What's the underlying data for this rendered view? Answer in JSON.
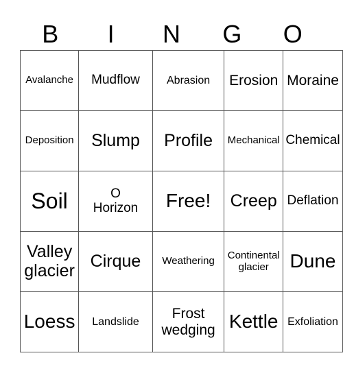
{
  "header": [
    "B",
    "I",
    "N",
    "G",
    "O"
  ],
  "rows": [
    [
      "Avalanche",
      "Mudflow",
      "Abrasion",
      "Erosion",
      "Moraine"
    ],
    [
      "Deposition",
      "Slump",
      "Profile",
      "Mechanical",
      "Chemical"
    ],
    [
      "Soil",
      "O Horizon",
      "Free!",
      "Creep",
      "Deflation"
    ],
    [
      "Valley glacier",
      "Cirque",
      "Weathering",
      "Continental glacier",
      "Dune"
    ],
    [
      "Loess",
      "Landslide",
      "Frost wedging",
      "Kettle",
      "Exfoliation"
    ]
  ]
}
